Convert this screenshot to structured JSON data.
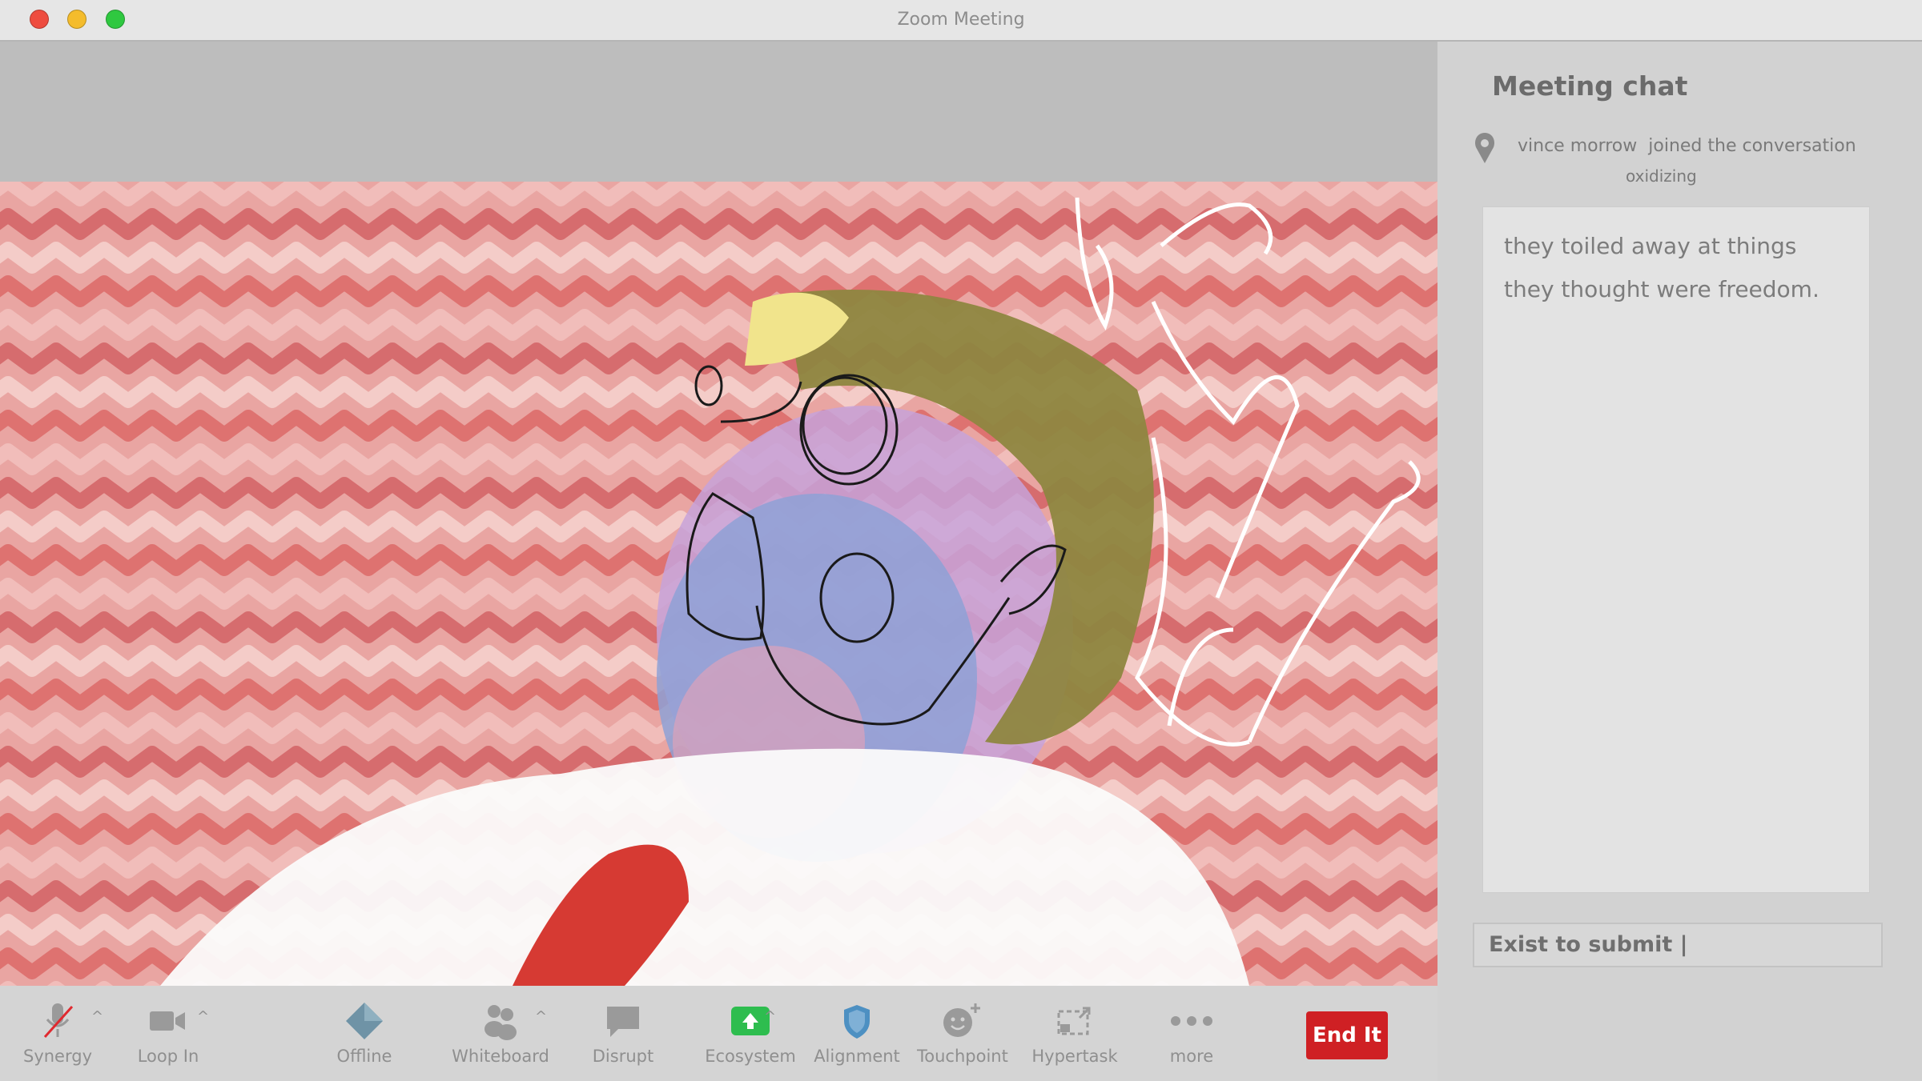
{
  "window": {
    "title": "Zoom Meeting"
  },
  "chat": {
    "heading": "Meeting chat",
    "join_user": "vince morrow",
    "join_text": "joined the conversation",
    "join_sub": "oxidizing",
    "messages": [
      "they toiled away at things",
      "they thought were freedom."
    ],
    "input_text": "Exist to submit |"
  },
  "toolbar": {
    "items": [
      {
        "label": "Synergy",
        "icon": "muted-mic-icon"
      },
      {
        "label": "Loop In",
        "icon": "video-camera-icon"
      },
      {
        "label": "Offline",
        "icon": "diamond-icon"
      },
      {
        "label": "Whiteboard",
        "icon": "participants-icon"
      },
      {
        "label": "Disrupt",
        "icon": "chat-bubble-icon"
      },
      {
        "label": "Ecosystem",
        "icon": "share-screen-icon"
      },
      {
        "label": "Alignment",
        "icon": "shield-icon"
      },
      {
        "label": "Touchpoint",
        "icon": "smiley-plus-icon"
      },
      {
        "label": "Hypertask",
        "icon": "breakout-icon"
      },
      {
        "label": "more",
        "icon": "more-dots-icon"
      }
    ],
    "end_label": "End It"
  },
  "colors": {
    "end_button": "#cf2024",
    "share_green": "#2ebd4f",
    "red_light": "#ee4c3f",
    "yellow_light": "#f4bc2c",
    "green_light": "#2fc840"
  }
}
